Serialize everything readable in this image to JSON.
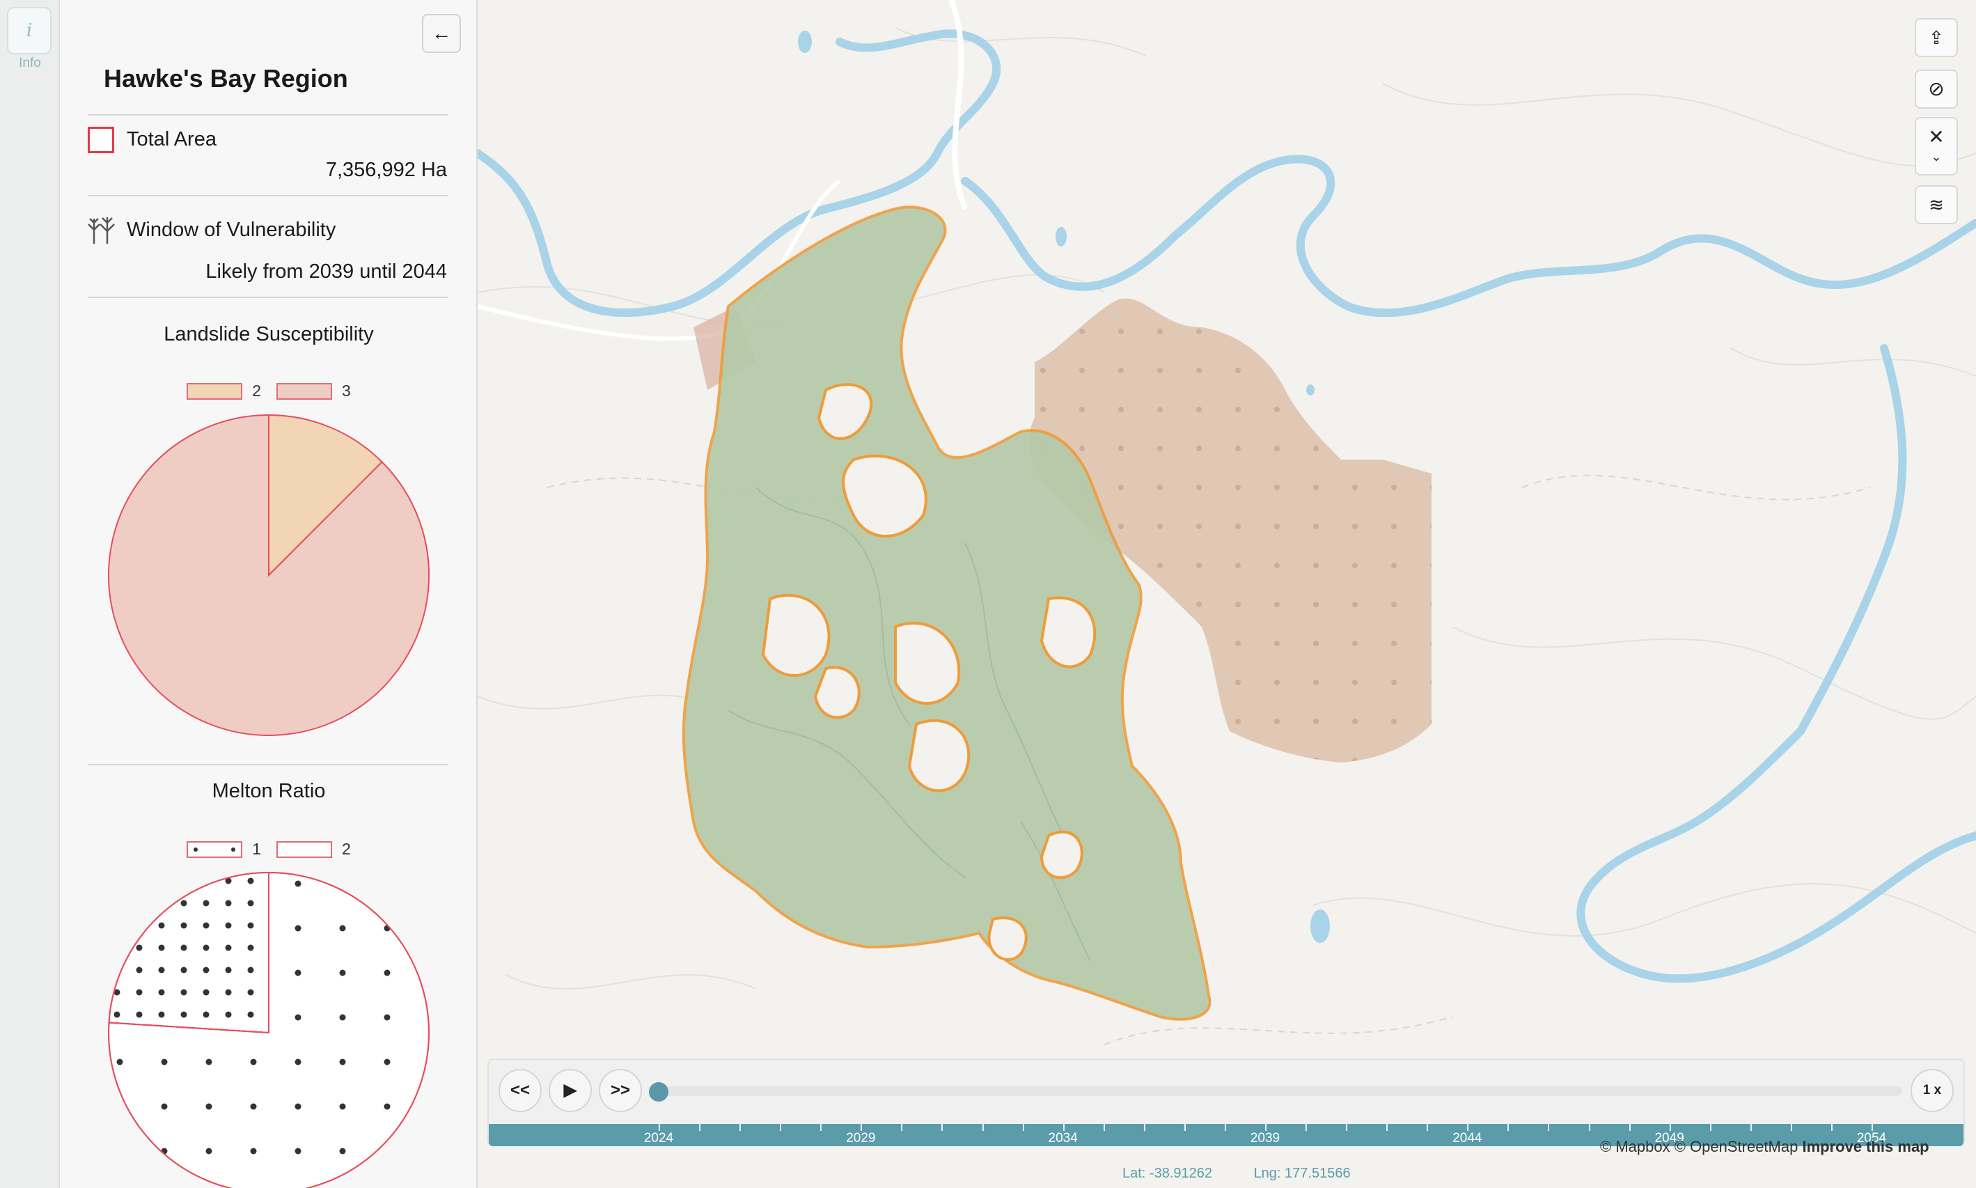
{
  "rail": {
    "info_icon": "i",
    "info_label": "Info"
  },
  "panel": {
    "back_icon": "←",
    "title": "Hawke's Bay Region",
    "total_area": {
      "label": "Total Area",
      "value": "7,356,992 Ha"
    },
    "vulnerability": {
      "label": "Window of Vulnerability",
      "value": "Likely from 2039 until 2044",
      "icon": "forest-icon"
    },
    "landslide": {
      "title": "Landslide Susceptibility",
      "legend": [
        "2",
        "3"
      ]
    },
    "melton": {
      "title": "Melton Ratio",
      "legend": [
        "1",
        "2"
      ]
    }
  },
  "chart_data": [
    {
      "type": "pie",
      "title": "Landslide Susceptibility",
      "categories": [
        "2",
        "3"
      ],
      "values": [
        12.5,
        87.5
      ],
      "colors": [
        "#f1d5b5",
        "#f0cdc4"
      ]
    },
    {
      "type": "pie",
      "title": "Melton Ratio",
      "categories": [
        "1",
        "2"
      ],
      "values": [
        24,
        76
      ],
      "colors": [
        "#ffffff",
        "#ffffff"
      ]
    }
  ],
  "map_controls": [
    "share-icon",
    "compass-icon",
    "tools-icon",
    "layers-icon"
  ],
  "timeline": {
    "rewind_label": "<<",
    "play_label": "▶",
    "forward_label": ">>",
    "speed_label": "1 x",
    "progress": 0,
    "years": [
      "2024",
      "2029",
      "2034",
      "2039",
      "2044",
      "2049",
      "2054"
    ]
  },
  "attribution": {
    "text": "© Mapbox © OpenStreetMap",
    "improve": "Improve this map"
  },
  "coords": {
    "lat": "Lat: -38.91262",
    "lng": "Lng: 177.51566"
  },
  "colors": {
    "accent": "#5a9caa",
    "forest": "#b7cdb0",
    "forest_outline": "#ef9b3a",
    "landslide_fill": "#d9b9a0",
    "river": "#a8d3e8"
  }
}
